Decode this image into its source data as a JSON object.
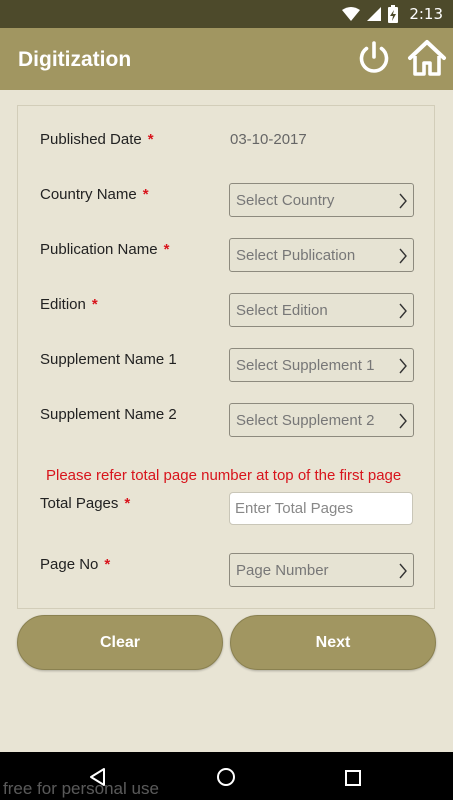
{
  "status_bar": {
    "time": "2:13"
  },
  "app_bar": {
    "title": "Digitization",
    "power_icon": "power-icon",
    "home_icon": "home-icon"
  },
  "form": {
    "published_date": {
      "label": "Published Date",
      "required": "*",
      "value": "03-10-2017"
    },
    "country": {
      "label": "Country Name",
      "required": "*",
      "placeholder": "Select Country"
    },
    "publication": {
      "label": "Publication Name",
      "required": "*",
      "placeholder": "Select Publication"
    },
    "edition": {
      "label": "Edition",
      "required": "*",
      "placeholder": "Select Edition"
    },
    "supplement1": {
      "label": "Supplement Name 1",
      "placeholder": "Select Supplement 1"
    },
    "supplement2": {
      "label": "Supplement Name 2",
      "placeholder": "Select Supplement 2"
    },
    "hint": "Please refer total page number at top of the first page",
    "total_pages": {
      "label": "Total Pages",
      "required": "*",
      "placeholder": "Enter Total Pages",
      "value": ""
    },
    "page_no": {
      "label": "Page No",
      "required": "*",
      "placeholder": "Page Number"
    }
  },
  "buttons": {
    "clear": "Clear",
    "next": "Next"
  },
  "watermark": "free for personal use",
  "colors": {
    "accent": "#a19661",
    "status_bar": "#4d4a2b",
    "background": "#e8e4d4",
    "required": "#d8141c"
  }
}
